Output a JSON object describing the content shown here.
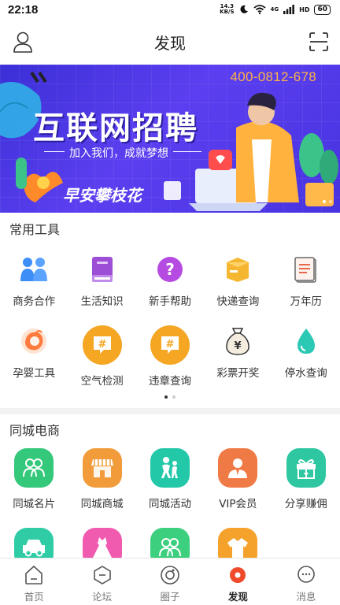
{
  "status": {
    "time": "22:18",
    "net_speed_value": "14.3",
    "net_speed_unit": "KB/S",
    "network": "4G",
    "hd": "HD",
    "battery": "60"
  },
  "header": {
    "title": "发现",
    "left_icon": "user-icon",
    "right_icon": "scan-icon"
  },
  "banner": {
    "phone": "400-0812-678",
    "headline": "互联网招聘",
    "subline": "加入我们，成就梦想",
    "brand": "早安攀枝花",
    "page_count": 2,
    "active_page": 1
  },
  "common_tools": {
    "title": "常用工具",
    "items": [
      {
        "label": "商务合作",
        "icon": "people-icon",
        "color": "#3d8ef7"
      },
      {
        "label": "生活知识",
        "icon": "book-icon",
        "color": "#9c4fd6"
      },
      {
        "label": "新手帮助",
        "icon": "question-icon",
        "color": "#b54be0"
      },
      {
        "label": "快递查询",
        "icon": "package-icon",
        "color": "#f5b731"
      },
      {
        "label": "万年历",
        "icon": "calendar-icon",
        "color": "#e8684a"
      },
      {
        "label": "孕婴工具",
        "icon": "baby-icon",
        "color": "#ff7a3d"
      },
      {
        "label": "空气检测",
        "icon": "hashtag-bubble-icon",
        "color": "#f5a623"
      },
      {
        "label": "违章查询",
        "icon": "hashtag-bubble-icon",
        "color": "#f5a623"
      },
      {
        "label": "彩票开奖",
        "icon": "money-bag-icon",
        "color": "#8a7760"
      },
      {
        "label": "停水查询",
        "icon": "water-drop-icon",
        "color": "#2bc9b4"
      }
    ],
    "pager": {
      "pages": 2,
      "active": 1
    }
  },
  "local_commerce": {
    "title": "同城电商",
    "items": [
      {
        "label": "同城名片",
        "icon": "contacts-icon",
        "color": "#34c87a"
      },
      {
        "label": "同城商城",
        "icon": "store-icon",
        "color": "#f29b3a"
      },
      {
        "label": "同城活动",
        "icon": "activity-icon",
        "color": "#23c8a9"
      },
      {
        "label": "VIP会员",
        "icon": "vip-icon",
        "color": "#f07a45"
      },
      {
        "label": "分享赚佣",
        "icon": "gift-icon",
        "color": "#2ec7a2"
      },
      {
        "label": "",
        "icon": "car-icon",
        "color": "#2fcca6"
      },
      {
        "label": "",
        "icon": "dress-icon",
        "color": "#f05bb0"
      },
      {
        "label": "",
        "icon": "group-icon",
        "color": "#3ccf7d"
      },
      {
        "label": "",
        "icon": "shirt-icon",
        "color": "#f5a22c"
      }
    ]
  },
  "bottom_nav": {
    "items": [
      {
        "label": "首页",
        "icon": "home-icon"
      },
      {
        "label": "论坛",
        "icon": "forum-icon"
      },
      {
        "label": "圈子",
        "icon": "circle-icon"
      },
      {
        "label": "发现",
        "icon": "discover-icon"
      },
      {
        "label": "消息",
        "icon": "message-icon"
      }
    ],
    "active_index": 3,
    "active_color": "#f04a2c"
  }
}
